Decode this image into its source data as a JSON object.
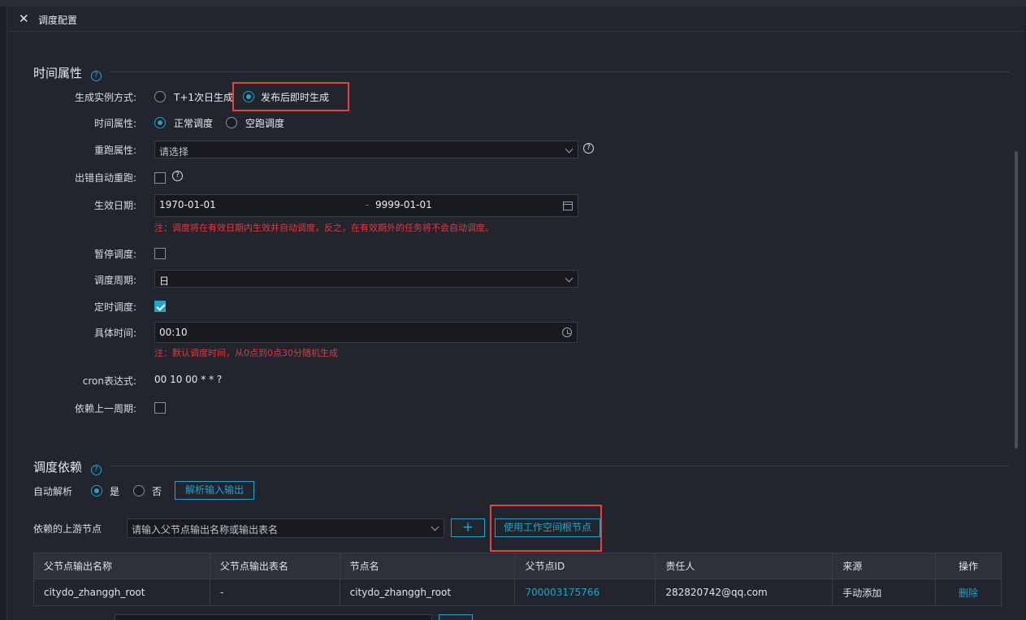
{
  "window": {
    "title": "调度配置"
  },
  "time_section": {
    "title": "时间属性",
    "instance_mode": {
      "label": "生成实例方式:",
      "option_a": "T+1次日生成",
      "option_b": "发布后即时生成",
      "selected": "option_b"
    },
    "time_attr": {
      "label": "时间属性:",
      "option_a": "正常调度",
      "option_b": "空跑调度",
      "selected": "option_a"
    },
    "rerun": {
      "label": "重跑属性:",
      "placeholder": "请选择"
    },
    "auto_rerun": {
      "label": "出错自动重跑:",
      "checked": false
    },
    "effective_date": {
      "label": "生效日期:",
      "start": "1970-01-01",
      "separator": "-",
      "end": "9999-01-01",
      "note": "注：调度将在有效日期内生效并自动调度，反之，在有效期外的任务将不会自动调度。"
    },
    "pause": {
      "label": "暂停调度:",
      "checked": false
    },
    "cycle": {
      "label": "调度周期:",
      "value": "日"
    },
    "timed": {
      "label": "定时调度:",
      "checked": true
    },
    "specific_time": {
      "label": "具体时间:",
      "value": "00:10",
      "note": "注：默认调度时间，从0点到0点30分随机生成"
    },
    "cron": {
      "label": "cron表达式:",
      "value": "00 10 00 * * ?"
    },
    "depend_prev": {
      "label": "依赖上一周期:",
      "checked": false
    }
  },
  "dep_section": {
    "title": "调度依赖",
    "auto_parse": {
      "label": "自动解析",
      "yes": "是",
      "no": "否",
      "selected": "yes",
      "button": "解析输入输出"
    },
    "upstream": {
      "label": "依赖的上游节点",
      "placeholder": "请输入父节点输出名称或输出表名",
      "add": "+",
      "root_button": "使用工作空间根节点"
    },
    "table": {
      "headers": [
        "父节点输出名称",
        "父节点输出表名",
        "节点名",
        "父节点ID",
        "责任人",
        "来源",
        "操作"
      ],
      "rows": [
        {
          "output_name": "citydo_zhanggh_root",
          "output_table": "-",
          "node_name": "citydo_zhanggh_root",
          "node_id": "700003175766",
          "owner": "282820742@qq.com",
          "source": "手动添加",
          "action": "删除"
        }
      ]
    }
  },
  "colors": {
    "accent": "#1ea5c9",
    "highlight": "#e8403b",
    "note": "#e0393e",
    "bg": "#23252e"
  }
}
